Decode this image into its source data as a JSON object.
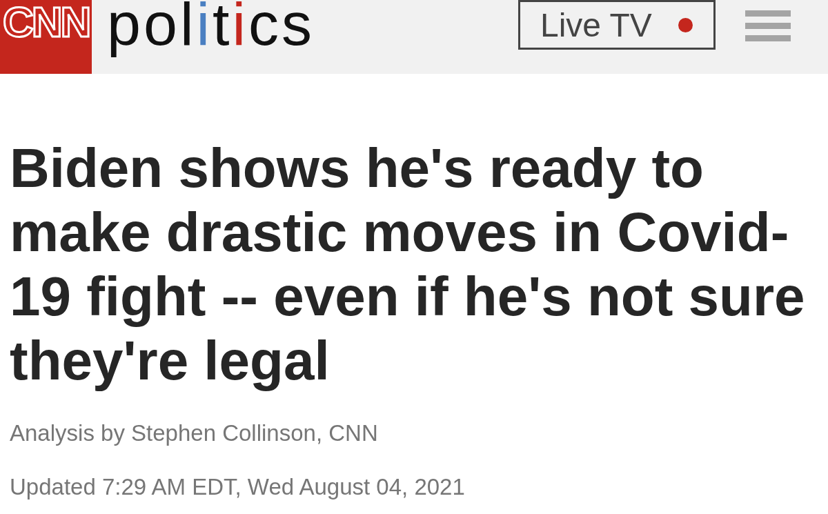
{
  "header": {
    "logo": {
      "text": "CNN"
    },
    "section": {
      "segments": [
        {
          "text": "pol"
        },
        {
          "text": "i",
          "color": "#4a7fc1"
        },
        {
          "text": "t"
        },
        {
          "text": "i",
          "color": "#c4261d"
        },
        {
          "text": "cs"
        }
      ]
    },
    "live_button": {
      "label": "Live TV",
      "live": true
    }
  },
  "article": {
    "headline": "Biden shows he's ready to make drastic moves in Covid-19 fight -- even if he's not sure they're legal",
    "byline": "Analysis by Stephen Collinson, CNN",
    "updated": "Updated 7:29 AM EDT, Wed August 04, 2021"
  }
}
